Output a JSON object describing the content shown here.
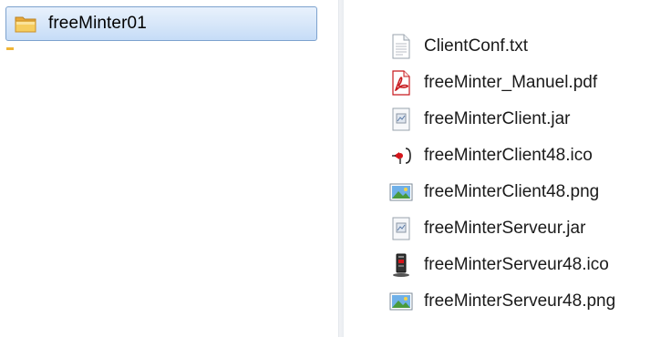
{
  "navigation": {
    "selected_folder": {
      "label": "freeMinter01",
      "icon": "folder-icon"
    }
  },
  "files": [
    {
      "name": "ClientConf.txt",
      "icon": "text-file-icon"
    },
    {
      "name": "freeMinter_Manuel.pdf",
      "icon": "pdf-file-icon"
    },
    {
      "name": "freeMinterClient.jar",
      "icon": "jar-file-icon"
    },
    {
      "name": "freeMinterClient48.ico",
      "icon": "ico-file-icon"
    },
    {
      "name": "freeMinterClient48.png",
      "icon": "image-file-icon"
    },
    {
      "name": "freeMinterServeur.jar",
      "icon": "jar-file-icon"
    },
    {
      "name": "freeMinterServeur48.ico",
      "icon": "server-ico-file-icon"
    },
    {
      "name": "freeMinterServeur48.png",
      "icon": "image-file-icon"
    }
  ],
  "colors": {
    "selection_border": "#7da2ce",
    "selection_fill": "#d6e6f9",
    "folder_yellow": "#f0b536",
    "pdf_red": "#c8191e"
  }
}
